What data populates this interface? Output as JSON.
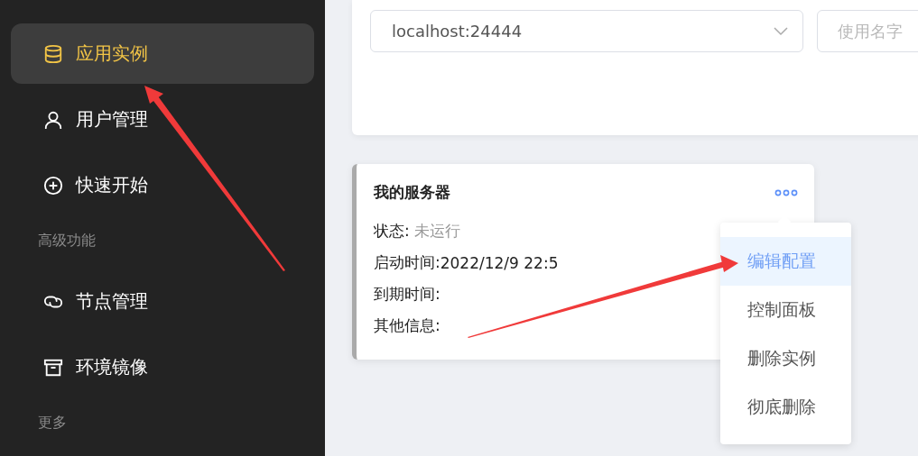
{
  "sidebar": {
    "entries": [
      {
        "kind": "item",
        "label": "应用实例",
        "selected": true
      },
      {
        "kind": "item",
        "label": "用户管理",
        "selected": false
      },
      {
        "kind": "item",
        "label": "快速开始",
        "selected": false
      },
      {
        "kind": "heading",
        "label": "高级功能"
      },
      {
        "kind": "item",
        "label": "节点管理",
        "selected": false
      },
      {
        "kind": "item",
        "label": "环境镜像",
        "selected": false
      },
      {
        "kind": "heading",
        "label": "更多"
      }
    ]
  },
  "filters": {
    "daemon_select": {
      "value": "localhost:24444"
    },
    "search": {
      "placeholder": "使用名字"
    }
  },
  "instance_card": {
    "title": "我的服务器",
    "fields": [
      {
        "label": "状态:",
        "value": "未运行",
        "muted": true
      },
      {
        "label": "启动时间:",
        "value": "2022/12/9 22:5",
        "muted": false
      },
      {
        "label": "到期时间:"
      },
      {
        "label": "其他信息:"
      }
    ]
  },
  "action_menu": {
    "items": [
      {
        "label": "编辑配置",
        "selected": true
      },
      {
        "label": "控制面板",
        "selected": false
      },
      {
        "label": "删除实例",
        "selected": false
      },
      {
        "label": "彻底删除",
        "selected": false
      }
    ]
  }
}
